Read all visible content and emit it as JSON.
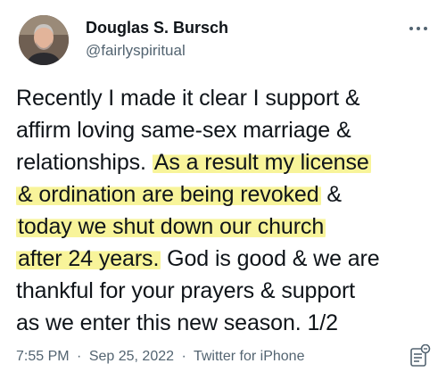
{
  "author": {
    "display_name": "Douglas S. Bursch",
    "handle": "@fairlyspiritual"
  },
  "tweet": {
    "lines": [
      {
        "a": "Recently I made it clear I support &",
        "hl": "",
        "b": ""
      },
      {
        "a": "affirm loving same-sex marriage &",
        "hl": "",
        "b": ""
      },
      {
        "a": "relationships. ",
        "hl": "As a result my license",
        "b": ""
      },
      {
        "a": "",
        "hl": "& ordination are being revoked",
        "b": " &"
      },
      {
        "a": "",
        "hl": "today we shut down our church",
        "b": ""
      },
      {
        "a": "",
        "hl": "after 24 years.",
        "b": " God is good & we are"
      },
      {
        "a": "thankful for your prayers & support",
        "hl": "",
        "b": ""
      },
      {
        "a": "as we enter this new season. 1/2",
        "hl": "",
        "b": ""
      }
    ]
  },
  "meta": {
    "time": "7:55 PM",
    "date": "Sep 25, 2022",
    "separator": "·",
    "source": "Twitter for iPhone"
  },
  "icons": {
    "more": "more-icon",
    "notes": "notes-icon",
    "avatar": "avatar"
  },
  "colors": {
    "highlight": "#f5f078",
    "secondary_text": "#536471",
    "primary_text": "#0f1419"
  }
}
